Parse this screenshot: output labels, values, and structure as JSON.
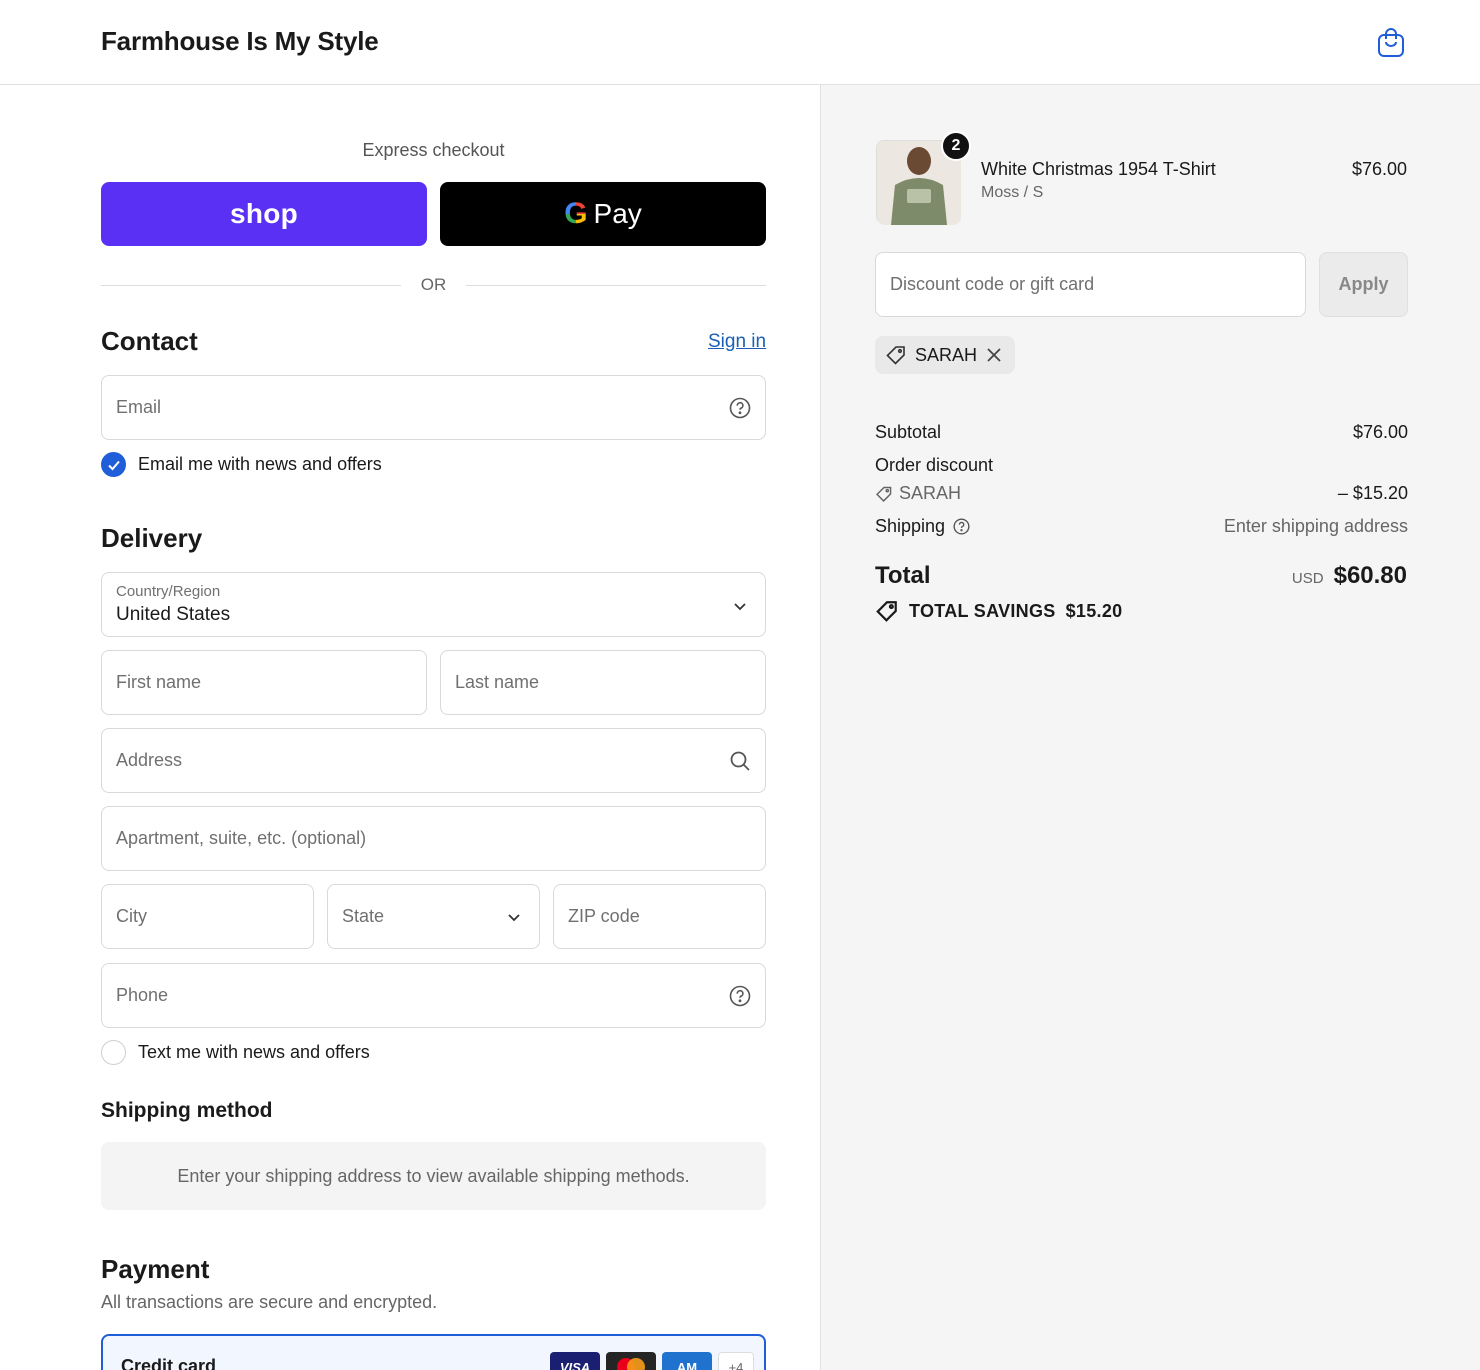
{
  "header": {
    "store_name": "Farmhouse Is My Style",
    "cart_icon": "shopping-bag-icon"
  },
  "express": {
    "label": "Express checkout",
    "shop_label": "shop",
    "gpay_label": "Pay",
    "gpay_g": "G",
    "or_label": "OR"
  },
  "contact": {
    "title": "Contact",
    "sign_in": "Sign in",
    "email_placeholder": "Email",
    "news_opt_in": "Email me with news and offers",
    "news_opt_in_checked": true
  },
  "delivery": {
    "title": "Delivery",
    "country_label": "Country/Region",
    "country_value": "United States",
    "first_name_placeholder": "First name",
    "last_name_placeholder": "Last name",
    "address_placeholder": "Address",
    "apartment_placeholder": "Apartment, suite, etc. (optional)",
    "city_placeholder": "City",
    "state_placeholder": "State",
    "zip_placeholder": "ZIP code",
    "phone_placeholder": "Phone",
    "text_opt_in": "Text me with news and offers",
    "text_opt_in_checked": false
  },
  "shipping_method": {
    "title": "Shipping method",
    "message": "Enter your shipping address to view available shipping methods."
  },
  "payment": {
    "title": "Payment",
    "subtitle": "All transactions are secure and encrypted.",
    "credit_card_label": "Credit card",
    "cards": [
      "VISA",
      "MC",
      "AM",
      "+4"
    ]
  },
  "order": {
    "product_name": "White Christmas 1954 T-Shirt",
    "product_variant": "Moss / S",
    "product_price": "$76.00",
    "quantity": "2",
    "discount_placeholder": "Discount code or gift card",
    "apply_label": "Apply",
    "applied_code": "SARAH",
    "subtotal_label": "Subtotal",
    "subtotal_value": "$76.00",
    "order_discount_label": "Order discount",
    "discount_code": "SARAH",
    "discount_value": "– $15.20",
    "shipping_label": "Shipping",
    "shipping_value": "Enter shipping address",
    "total_label": "Total",
    "total_currency": "USD",
    "total_value": "$60.80",
    "savings_label": "TOTAL SAVINGS",
    "savings_value": "$15.20"
  },
  "colors": {
    "shop_purple": "#5a31f4",
    "link_blue": "#1a5fb4",
    "checkbox_blue": "#1f5ed8"
  }
}
